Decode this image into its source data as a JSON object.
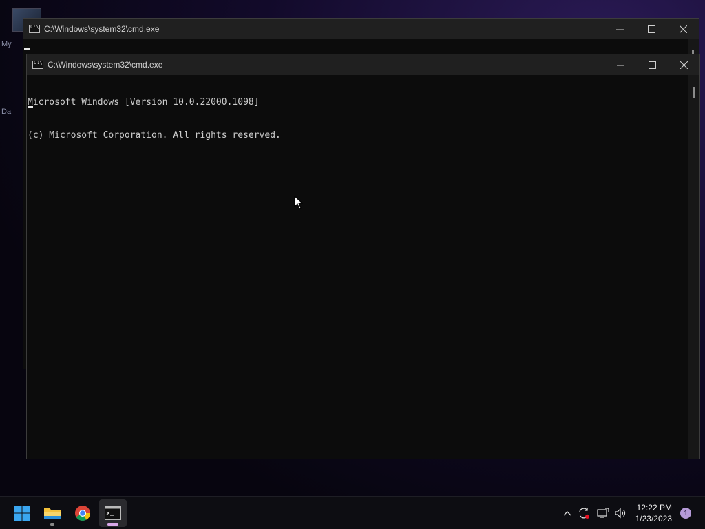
{
  "desktop": {
    "label_1": "My",
    "label_2": "Da"
  },
  "back_window": {
    "title": "C:\\Windows\\system32\\cmd.exe"
  },
  "front_window": {
    "title": "C:\\Windows\\system32\\cmd.exe",
    "console_line_1": "Microsoft Windows [Version 10.0.22000.1098]",
    "console_line_2": "(c) Microsoft Corporation. All rights reserved."
  },
  "icons": {
    "start": "windows-start-icon",
    "explorer": "file-explorer-icon",
    "chrome": "chrome-icon",
    "terminal": "command-prompt-icon",
    "chevron": "chevron-up-icon",
    "sync": "sync-icon",
    "network": "network-icon",
    "volume": "volume-icon"
  },
  "taskbar": {
    "time": "12:22 PM",
    "date": "1/23/2023",
    "notification_count": "1"
  },
  "colors": {
    "accent": "#0078d4",
    "console_bg": "#0c0c0c",
    "titlebar": "#202020"
  }
}
